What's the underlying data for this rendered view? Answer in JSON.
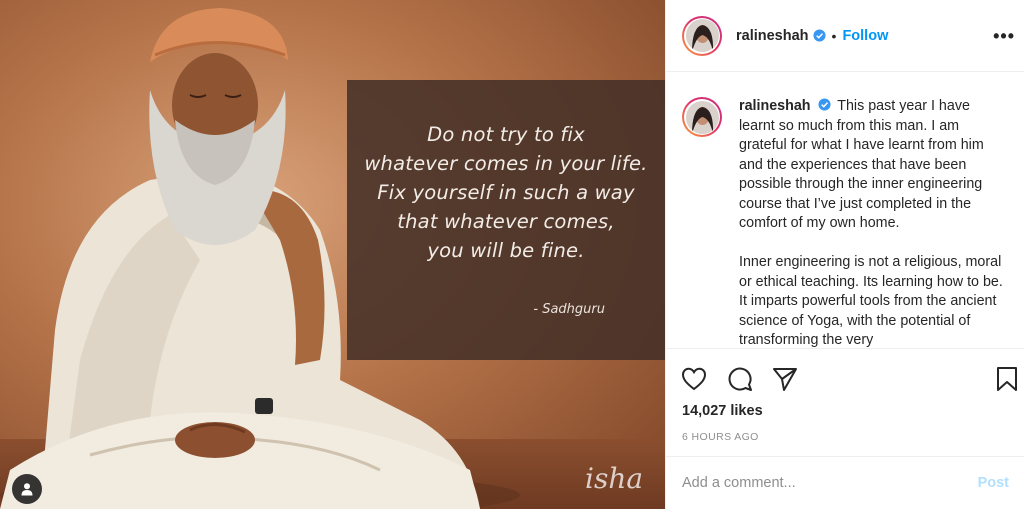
{
  "post": {
    "quote": {
      "lines": [
        "Do not try to fix",
        "whatever comes in your life.",
        "Fix yourself in such a way",
        "that whatever comes,",
        "you will be fine."
      ],
      "author": "- Sadhguru",
      "watermark": "isha"
    },
    "header": {
      "username": "ralineshah",
      "dot": "•",
      "follow": "Follow",
      "more": "•••"
    },
    "caption": {
      "username": "ralineshah",
      "para1": "This past year I have learnt so much from this man. I am grateful for what I have learnt from him and the experiences that have been possible through the inner engineering course that I’ve just completed in the comfort of my own home.",
      "para2": "Inner engineering is not a religious, moral or ethical teaching. Its learning how to be. It imparts powerful tools from the ancient science of Yoga, with the potential of transforming the very"
    },
    "likes": "14,027 likes",
    "time": "6 HOURS AGO",
    "comment": {
      "placeholder": "Add a comment...",
      "post": "Post"
    }
  },
  "colors": {
    "accent": "#0095f6",
    "post_disabled": "#b2dffc",
    "muted": "#8e8e8e"
  },
  "icons": [
    "tag-user-icon",
    "verified-icon",
    "heart-icon",
    "comment-icon",
    "share-icon",
    "bookmark-icon",
    "more-icon"
  ]
}
